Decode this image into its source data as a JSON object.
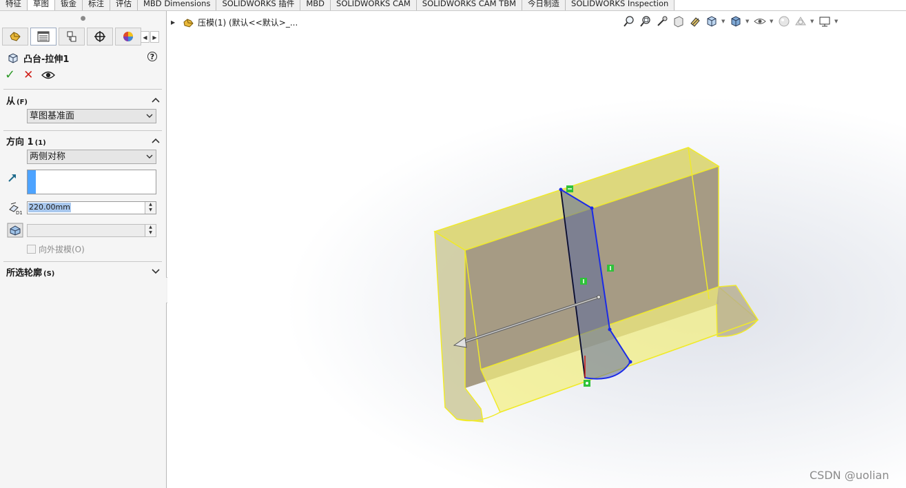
{
  "tabs": [
    {
      "label": "特征",
      "active": false
    },
    {
      "label": "草图",
      "active": true
    },
    {
      "label": "钣金",
      "active": false
    },
    {
      "label": "标注",
      "active": false
    },
    {
      "label": "评估",
      "active": false
    },
    {
      "label": "MBD Dimensions",
      "active": false
    },
    {
      "label": "SOLIDWORKS 插件",
      "active": false
    },
    {
      "label": "MBD",
      "active": false
    },
    {
      "label": "SOLIDWORKS CAM",
      "active": false
    },
    {
      "label": "SOLIDWORKS CAM TBM",
      "active": false
    },
    {
      "label": "今日制造",
      "active": false
    },
    {
      "label": "SOLIDWORKS Inspection",
      "active": false
    }
  ],
  "property_manager": {
    "title": "凸台-拉伸1",
    "help": "?",
    "icons": [
      "featuremanager-icon",
      "propertymanager-icon",
      "configurationmanager-icon",
      "dimxpert-icon",
      "display-manager-icon"
    ],
    "from_section": {
      "label": "从",
      "shortcut": "(F)",
      "value": "草图基准面"
    },
    "direction_section": {
      "label": "方向 1",
      "shortcut": "(1)",
      "end_condition": "两侧对称",
      "depth": "220.00mm",
      "draft_checkbox_label": "向外拔模(O)",
      "draft_checked": false
    },
    "contours_section": {
      "label": "所选轮廓",
      "shortcut": "(S)"
    }
  },
  "viewport": {
    "tree_text": "压模(1)  (默认<<默认>_...",
    "hud_icons": [
      "zoom-to-fit-icon",
      "zoom-to-area-icon",
      "previous-view-icon",
      "section-view-icon",
      "dynamic-annotation-icon",
      "view-orientation-icon",
      "display-style-icon",
      "hide-show-items-icon",
      "edit-appearance-icon",
      "apply-scene-icon",
      "view-settings-icon"
    ],
    "model_colors": {
      "face": "#a69b84",
      "highlight": "#f3f07d",
      "edge": "#f0ea2a",
      "sketch": "#1a2ae8"
    }
  },
  "watermark": "CSDN @uolian"
}
